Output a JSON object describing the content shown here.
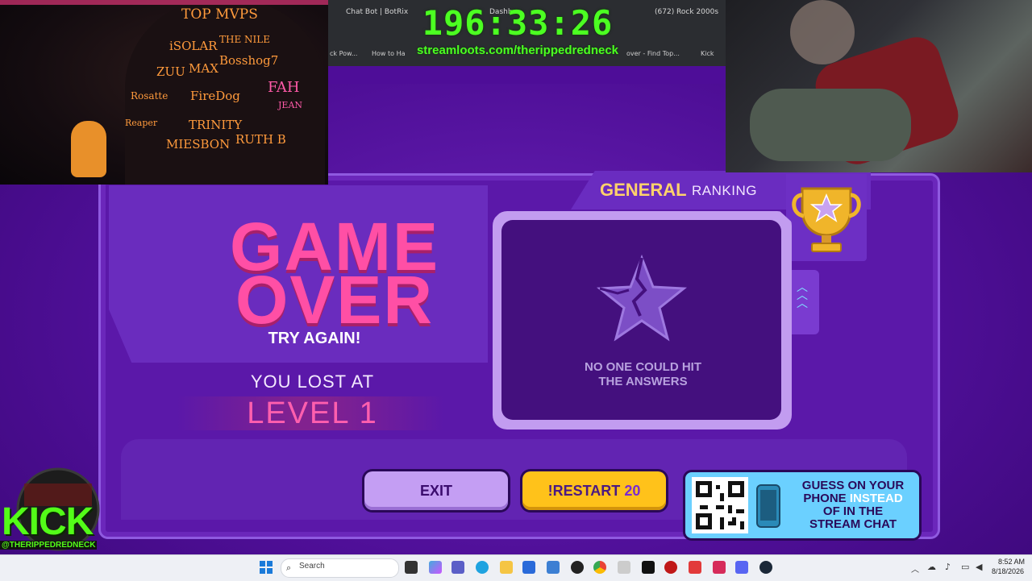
{
  "timer": "196:33:26",
  "overlay_url": "streamloots.com/therippedredneck",
  "browser": {
    "tabs": [
      "Chat Bot | BotRix",
      "Dashb",
      "(672) Rock 2000s"
    ],
    "bookmarks": [
      "ck Pow...",
      "How to Ha",
      "over - Find Top...",
      "Kick"
    ]
  },
  "cam_left": {
    "signatures": [
      "TOP MVPS",
      "iSOLAR",
      "THE NILE",
      "ZUU",
      "MAX",
      "Bosshog7",
      "Rosatte",
      "FireDog",
      "FAH",
      "JEAN",
      "Reaper",
      "TRINITY",
      "MIESBON",
      "RUTH B"
    ]
  },
  "game": {
    "game_over_line1": "GAME",
    "game_over_line2": "OVER",
    "try_again": "TRY AGAIN!",
    "lost_at": "YOU LOST AT",
    "level": "LEVEL 1",
    "ranking": {
      "title": "GENERAL",
      "subtitle": "RANKING",
      "empty_message_line1": "NO ONE COULD HIT",
      "empty_message_line2": "THE ANSWERS"
    },
    "exit_label": "EXIT",
    "restart_label": "!RESTART",
    "restart_count": "20",
    "qr_panel": {
      "line1": "GUESS ON YOUR",
      "line2a": "PHONE ",
      "line2b": "INSTEAD",
      "line3": "OF IN THE",
      "line4": "STREAM CHAT"
    }
  },
  "kick": {
    "logo_text": "KICK",
    "handle": "@THERIPPEDREDNECK"
  },
  "taskbar": {
    "search_placeholder": "Search",
    "time": "8:52 AM",
    "date": "8/18/2026"
  },
  "colors": {
    "accent_pink": "#ff4fa5",
    "accent_yellow": "#ffc21a",
    "timer_green": "#4cff22",
    "kick_green": "#53fc18",
    "panel_purple": "#5b18a9"
  }
}
